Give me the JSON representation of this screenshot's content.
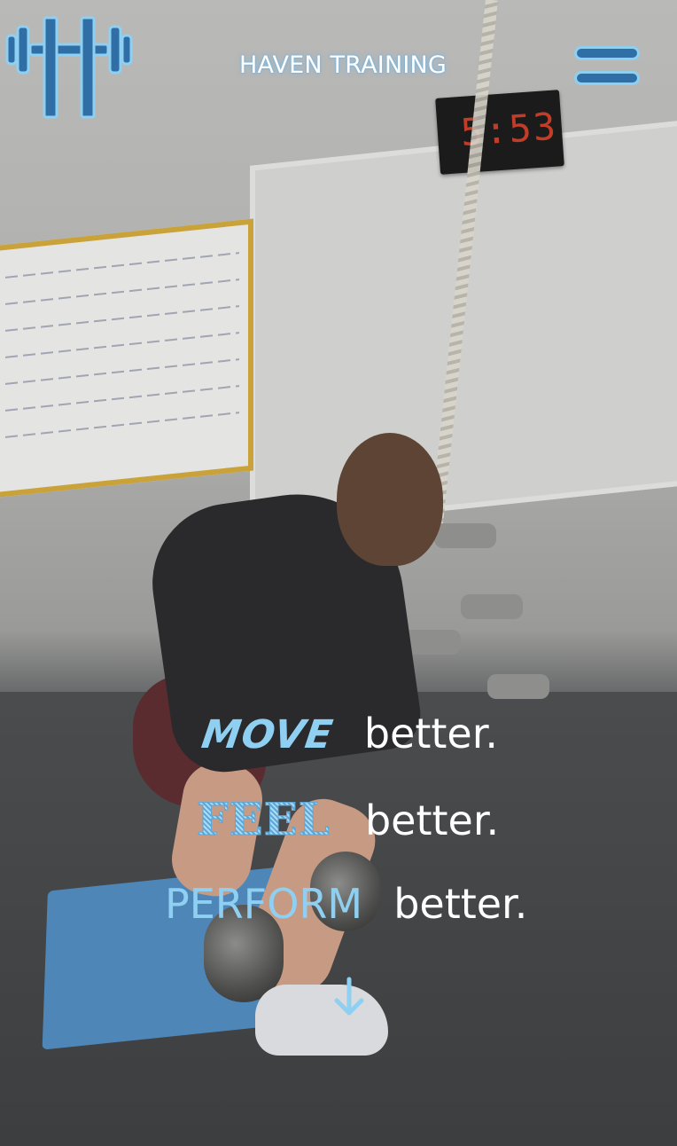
{
  "header": {
    "site_title": "HAVEN TRAINING",
    "logo_icon": "dumbbell-h-logo-icon",
    "menu_icon": "hamburger-menu-icon"
  },
  "hero": {
    "timer_display": "5:53",
    "tagline": [
      {
        "accent": "MOVE",
        "rest": "better."
      },
      {
        "accent": "FEEL",
        "rest": "better."
      },
      {
        "accent": "PERFORM",
        "rest": "better."
      }
    ],
    "scroll_icon": "arrow-down-icon"
  },
  "colors": {
    "accent_light": "#8fd0f2",
    "accent_dark": "#2f6fa6",
    "text": "#ffffff"
  }
}
